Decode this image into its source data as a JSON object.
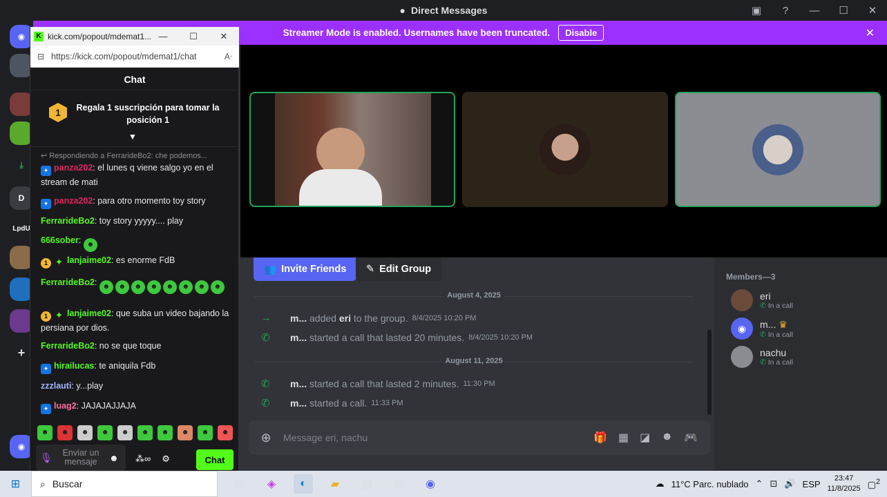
{
  "discord": {
    "window_title": "Direct Messages",
    "banner": {
      "text": "Streamer Mode is enabled. Usernames have been truncated.",
      "button": "Disable"
    },
    "guilds": [
      "D",
      "LpdU"
    ],
    "actions": {
      "invite": "Invite Friends",
      "edit": "Edit Group"
    },
    "dividers": [
      "August 4, 2025",
      "August 11, 2025"
    ],
    "messages": [
      {
        "user": "m...",
        "before": "added",
        "bold": "eri",
        "after": "to the group.",
        "time": "8/4/2025 10:20 PM",
        "icon": "arrow-right-icon"
      },
      {
        "user": "m...",
        "before": "started a call that lasted 20 minutes.",
        "bold": "",
        "after": "",
        "time": "8/4/2025 10:20 PM",
        "icon": "phone-icon"
      },
      {
        "user": "m...",
        "before": "started a call that lasted 2 minutes.",
        "bold": "",
        "after": "",
        "time": "11:30 PM",
        "icon": "phone-icon"
      },
      {
        "user": "m...",
        "before": "started a call.",
        "bold": "",
        "after": "",
        "time": "11:33 PM",
        "icon": "phone-icon"
      }
    ],
    "composer_placeholder": "Message eri, nachu",
    "members_header": "Members—3",
    "members": [
      {
        "name": "eri",
        "status": "In a call"
      },
      {
        "name": "m...",
        "status": "In a call"
      },
      {
        "name": "nachu",
        "status": "In a call"
      }
    ],
    "accent": "#9b30ff",
    "call_green": "#23a55a"
  },
  "kick": {
    "tab_title": "kick.com/popout/mdemat1...",
    "url": "https://kick.com/popout/mdemat1/chat",
    "header": "Chat",
    "pinned": {
      "rank": "1",
      "text": "Regala 1 suscripción para tomar la posición 1"
    },
    "reply_line": "Respondiendo a FerrarideBo2: che podemos...",
    "messages": [
      {
        "user": "panza202",
        "color": "#e0245e",
        "text": ": el lunes q viene salgo yo en el stream de mati",
        "badge": "vip"
      },
      {
        "user": "panza202",
        "color": "#e0245e",
        "text": ": para otro momento toy story",
        "badge": "vip"
      },
      {
        "user": "FerrarideBo2",
        "color": "#53fc18",
        "text": ": toy story yyyyy.... play",
        "badge": ""
      },
      {
        "user": "666sober",
        "color": "#53fc18",
        "text": ":",
        "badge": ""
      },
      {
        "user": "lanjaime02",
        "color": "#53fc18",
        "text": ": es enorme FdB",
        "badge": "sub"
      },
      {
        "user": "FerrarideBo2",
        "color": "#53fc18",
        "text": ":",
        "badge": ""
      },
      {
        "user": "lanjaime02",
        "color": "#53fc18",
        "text": ": que suba un video bajando la persiana por dios.",
        "badge": "sub"
      },
      {
        "user": "FerrarideBo2",
        "color": "#53fc18",
        "text": ": no se que toque",
        "badge": ""
      },
      {
        "user": "hirailucas",
        "color": "#53fc18",
        "text": ": te aniquila Fdb",
        "badge": "vip"
      },
      {
        "user": "zzzlauti",
        "color": "#a3b5ff",
        "text": ": y...play",
        "badge": ""
      },
      {
        "user": "luag2",
        "color": "#ff6b9a",
        "text": ": JAJAJAJJAJA",
        "badge": "vip"
      }
    ],
    "sub_rank": "1",
    "input_placeholder": "Enviar un mensaje",
    "chat_button": "Chat",
    "brand": "#53fc18"
  },
  "taskbar": {
    "search": "Buscar",
    "weather": "11°C  Parc. nublado",
    "lang": "ESP",
    "time": "23:47",
    "date": "11/8/2025",
    "notifications": "2"
  }
}
